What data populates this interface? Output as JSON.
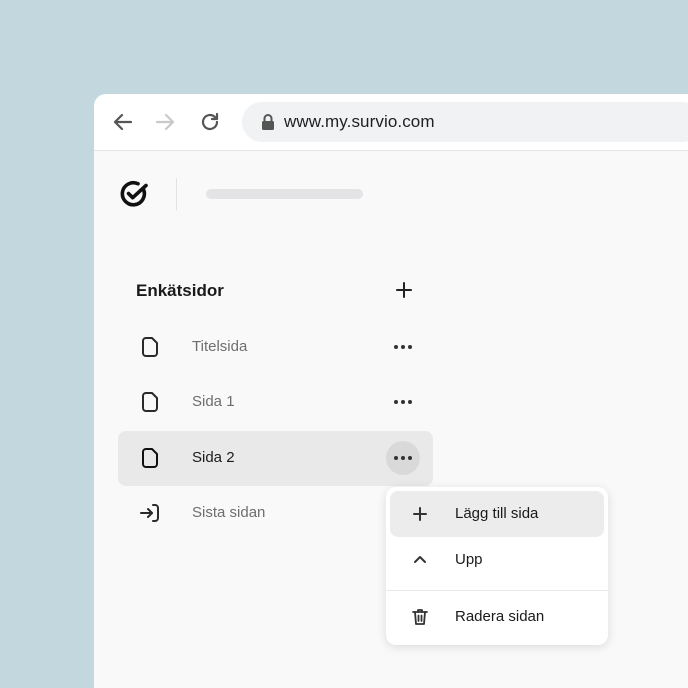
{
  "browser": {
    "url": "www.my.survio.com",
    "icons": [
      "back-arrow-icon",
      "forward-arrow-icon",
      "reload-icon",
      "lock-icon"
    ]
  },
  "app": {
    "logo_icon": "survio-check-logo-icon"
  },
  "sidebar": {
    "title": "Enkätsidor",
    "add_icon": "plus-icon",
    "pages": [
      {
        "label": "Titelsida",
        "icon": "page-icon",
        "active": false
      },
      {
        "label": "Sida 1",
        "icon": "page-icon",
        "active": false
      },
      {
        "label": "Sida 2",
        "icon": "page-icon",
        "active": true
      },
      {
        "label": "Sista sidan",
        "icon": "exit-arrow-icon",
        "active": false
      }
    ]
  },
  "context_menu": {
    "items": [
      {
        "label": "Lägg till sida",
        "icon": "plus-icon",
        "hover": true
      },
      {
        "label": "Upp",
        "icon": "chevron-up-icon",
        "hover": false
      },
      {
        "label": "Radera sidan",
        "icon": "trash-icon",
        "hover": false
      }
    ]
  },
  "colors": {
    "background": "#c2d8de",
    "panel": "#f9f9f9",
    "active_row": "#e9e9e9",
    "text_primary": "#1a1a1a",
    "text_muted": "#6e6e6e"
  }
}
